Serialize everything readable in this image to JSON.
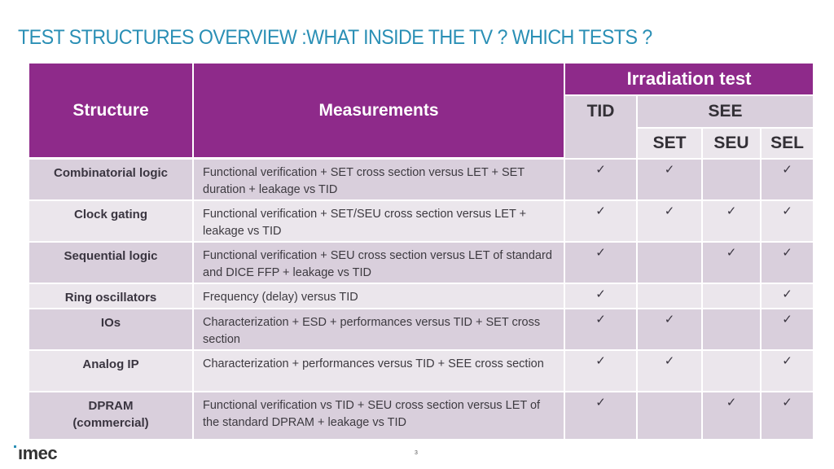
{
  "slide": {
    "title": "TEST STRUCTURES OVERVIEW :WHAT INSIDE THE TV ?  WHICH TESTS ?",
    "page_number": "3",
    "logo_text": "ımec"
  },
  "table": {
    "headers": {
      "structure": "Structure",
      "measurements": "Measurements",
      "irradiation_test": "Irradiation test",
      "tid": "TID",
      "see": "SEE",
      "set": "SET",
      "seu": "SEU",
      "sel": "SEL"
    },
    "check_symbol": "✓",
    "rows": [
      {
        "structure": "Combinatorial logic",
        "measurements": "Functional verification + SET cross section versus LET + SET duration + leakage vs TID",
        "tid": true,
        "set": true,
        "seu": false,
        "sel": true
      },
      {
        "structure": "Clock gating",
        "measurements": "Functional verification + SET/SEU cross section versus LET + leakage vs TID",
        "tid": true,
        "set": true,
        "seu": true,
        "sel": true
      },
      {
        "structure": "Sequential logic",
        "measurements": "Functional verification + SEU cross section versus LET of standard and DICE FFP + leakage vs TID",
        "tid": true,
        "set": false,
        "seu": true,
        "sel": true
      },
      {
        "structure": "Ring oscillators",
        "measurements": "Frequency (delay) versus TID",
        "tid": true,
        "set": false,
        "seu": false,
        "sel": true
      },
      {
        "structure": "IOs",
        "measurements": "Characterization + ESD + performances versus TID + SET cross section",
        "tid": true,
        "set": true,
        "seu": false,
        "sel": true
      },
      {
        "structure": "Analog IP",
        "measurements": "Characterization + performances versus TID + SEE cross section",
        "tid": true,
        "set": true,
        "seu": false,
        "sel": true
      },
      {
        "structure": "DPRAM (commercial)",
        "measurements": "Functional verification vs TID + SEU cross section versus LET of the standard DPRAM + leakage vs TID",
        "tid": true,
        "set": false,
        "seu": true,
        "sel": true
      }
    ]
  }
}
